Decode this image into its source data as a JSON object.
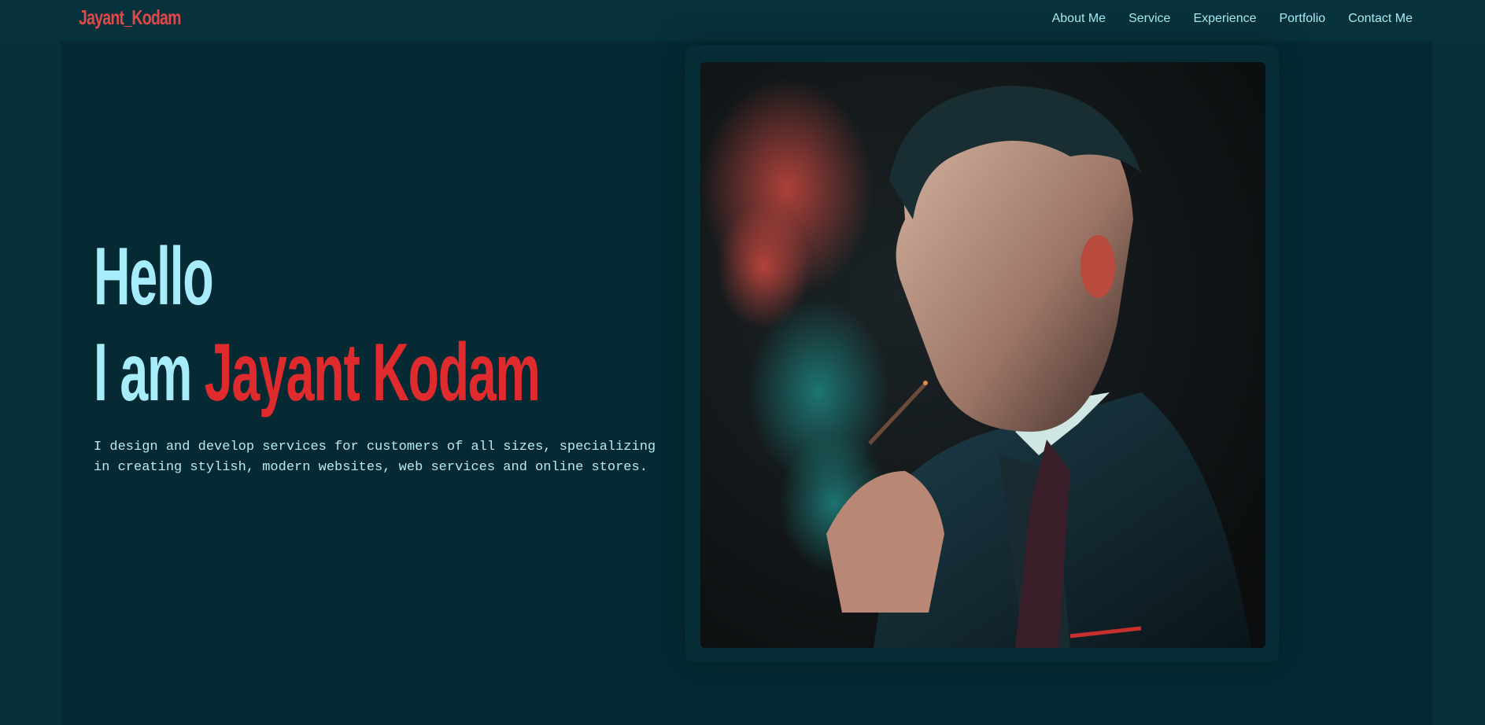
{
  "header": {
    "logo": "Jayant_Kodam",
    "nav": [
      {
        "label": "About Me"
      },
      {
        "label": "Service"
      },
      {
        "label": "Experience"
      },
      {
        "label": "Portfolio"
      },
      {
        "label": "Contact Me"
      }
    ]
  },
  "hero": {
    "greeting": "Hello",
    "intro_prefix": "I am",
    "name": "Jayant Kodam",
    "description": "I design and develop services for customers of all sizes, specializing in creating stylish, modern websites, web services and online stores."
  },
  "colors": {
    "background": "#073039",
    "panel": "#052a34",
    "accent_red": "#df2b2e",
    "accent_cyan": "#a6ecfb"
  },
  "icons": []
}
